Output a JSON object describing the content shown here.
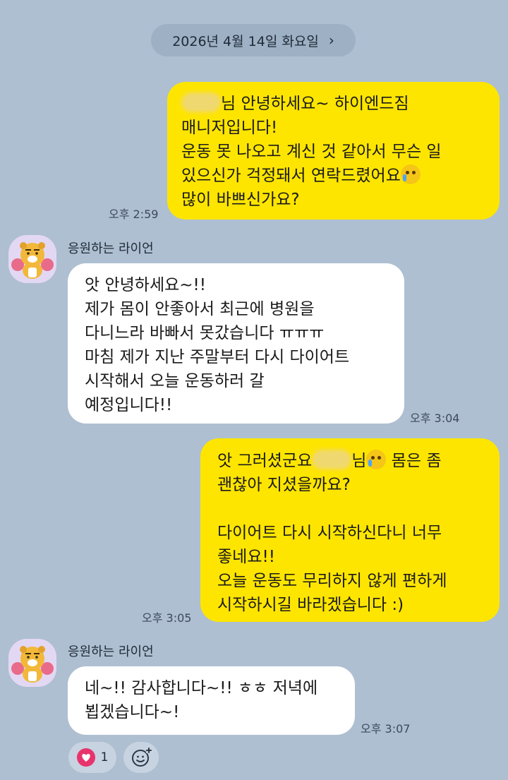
{
  "date_divider": {
    "label": "2026년 4월 14일 화요일",
    "chevron": "chevron-right-icon"
  },
  "messages": [
    {
      "direction": "outgoing",
      "text_lead": "님 안녕하세요~ 하이엔드짐",
      "text_rest": "매니저입니다!\n운동 못 나오고 계신 것 같아서 무슨 일\n있으신가 걱정돼서 연락드렸어요",
      "text_tail": "\n많이 바쁘신가요?",
      "emoji": "crying-face-emoji",
      "time": "오후 2:59"
    },
    {
      "direction": "incoming",
      "sender": "응원하는 라이언",
      "text": "앗 안녕하세요~!!\n제가 몸이 안좋아서 최근에 병원을\n다니느라 바빠서 못갔습니다 ㅠㅠㅠ\n마침 제가 지난 주말부터 다시 다이어트\n시작해서 오늘 운동하러 갈\n예정입니다!!",
      "time": "오후 3:04"
    },
    {
      "direction": "outgoing",
      "text_a": "앗 그러셨군요",
      "text_b": "님",
      "text_c": " 몸은 좀",
      "text_rest": "괜찮아 지셨을까요?\n\n다이어트 다시 시작하신다니 너무\n좋네요!!\n오늘 운동도 무리하지 않게 편하게\n시작하시길 바라겠습니다 :)",
      "emoji": "smiling-face-with-tear-emoji",
      "time": "오후 3:05"
    },
    {
      "direction": "incoming",
      "sender": "응원하는 라이언",
      "text": "네~!! 감사합니다~!! ㅎㅎ 저녁에\n뵙겠습니다~!",
      "time": "오후 3:07",
      "reaction_count": "1"
    }
  ],
  "colors": {
    "background": "#aebfd1",
    "outgoing_bubble": "#fee500",
    "incoming_bubble": "#ffffff",
    "heart": "#e8336d"
  }
}
